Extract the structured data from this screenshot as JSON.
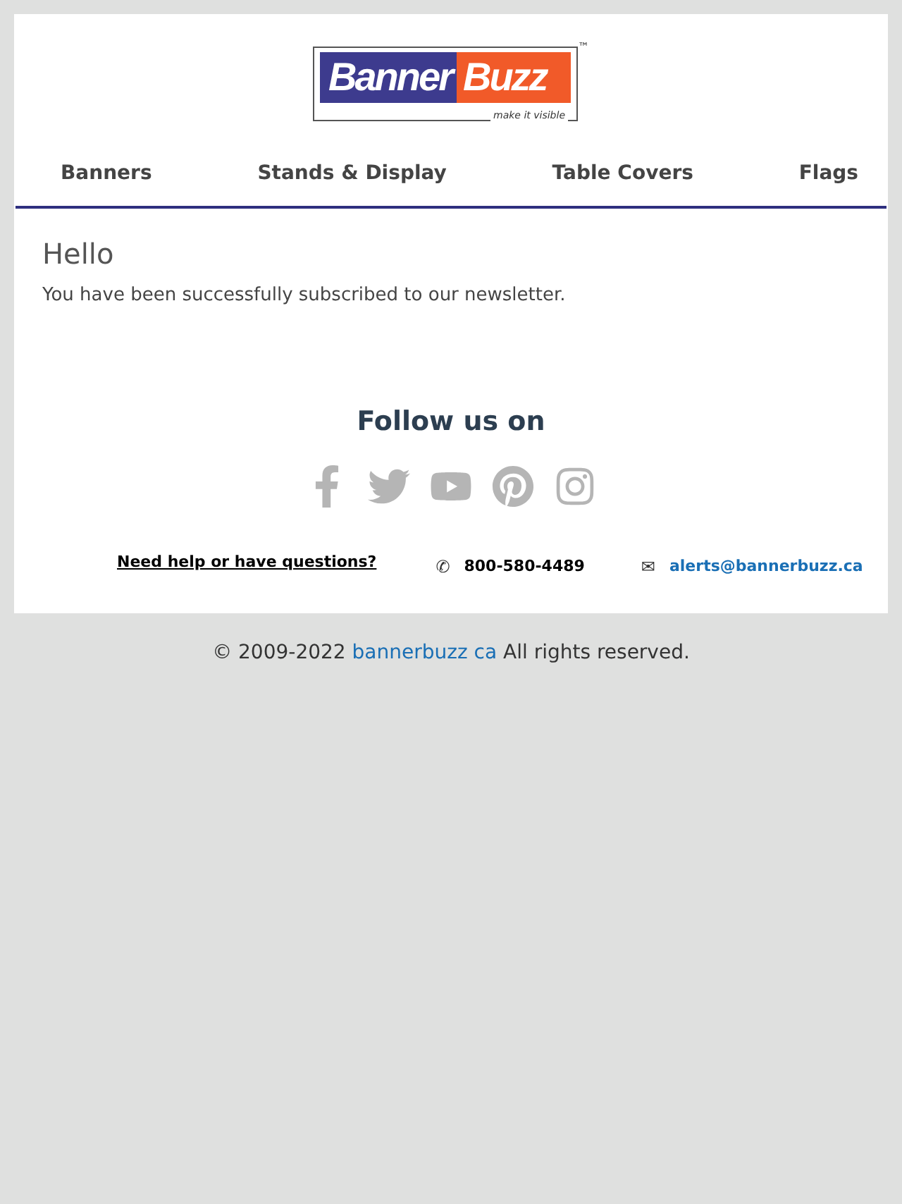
{
  "logo": {
    "word_1": "Banner",
    "word_2": "Buzz",
    "tagline": "make it visible",
    "trademark": "™"
  },
  "nav": [
    {
      "label": "Banners"
    },
    {
      "label": "Stands & Display"
    },
    {
      "label": "Table Covers"
    },
    {
      "label": "Flags"
    }
  ],
  "message": {
    "title": "Hello",
    "body": "You have been successfully subscribed to our newsletter."
  },
  "social": {
    "title": "Follow us on",
    "icons": [
      {
        "kind": "facebook"
      },
      {
        "kind": "twitter"
      },
      {
        "kind": "youtube"
      },
      {
        "kind": "pinterest"
      },
      {
        "kind": "instagram"
      }
    ]
  },
  "contact": {
    "help_link": "Need help or have questions?",
    "phone_icon": "✆",
    "phone": "800-580-4489",
    "mail_icon": "✉",
    "email": "alerts@bannerbuzz.ca"
  },
  "footer": {
    "prefix": "© 2009-2022",
    "link": "bannerbuzz ca",
    "suffix": "All rights reserved."
  }
}
